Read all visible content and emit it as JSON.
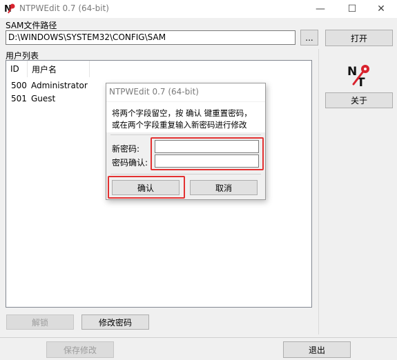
{
  "window": {
    "title": "NTPWEdit 0.7 (64-bit)",
    "minimize_glyph": "—",
    "maximize_glyph": "☐",
    "close_glyph": "✕"
  },
  "sam": {
    "label": "SAM文件路径",
    "path": "D:\\WINDOWS\\SYSTEM32\\CONFIG\\SAM",
    "browse_label": "...",
    "open_label": "打开"
  },
  "userlist": {
    "label": "用户列表",
    "columns": [
      "ID",
      "用户名"
    ],
    "rows": [
      {
        "id": "500",
        "name": "Administrator"
      },
      {
        "id": "501",
        "name": "Guest"
      }
    ]
  },
  "side": {
    "about_label": "关于",
    "logo_text_n": "N",
    "logo_text_t": "T"
  },
  "actions": {
    "unlock_label": "解锁",
    "change_password_label": "修改密码",
    "save_label": "保存修改",
    "exit_label": "退出"
  },
  "dialog": {
    "title": "NTPWEdit 0.7 (64-bit)",
    "message_line1": "将两个字段留空，按 确认 键重置密码，",
    "message_line2": "或在两个字段重复输入新密码进行修改",
    "new_password_label": "新密码:",
    "confirm_password_label": "密码确认:",
    "new_password_value": "",
    "confirm_password_value": "",
    "ok_label": "确认",
    "cancel_label": "取消"
  },
  "colors": {
    "highlight": "#e33131",
    "logo_red": "#d9232e"
  }
}
